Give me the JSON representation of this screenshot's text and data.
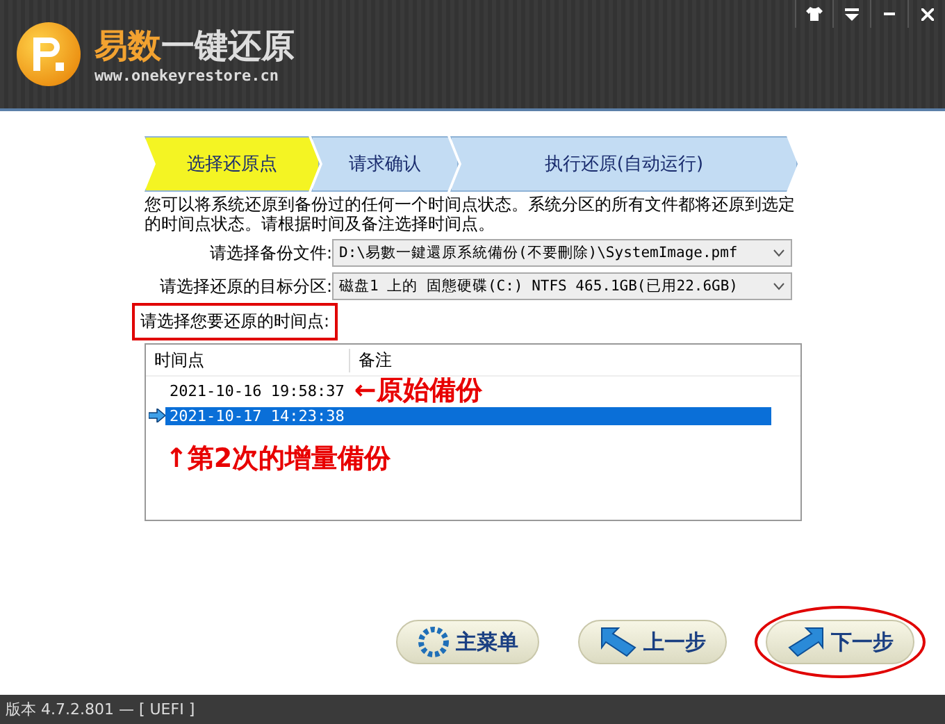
{
  "header": {
    "title_accent": "易数",
    "title_rest": "一键还原",
    "website": "www.onekeyrestore.cn"
  },
  "window_controls": [
    {
      "kind": "skin"
    },
    {
      "kind": "menu"
    },
    {
      "kind": "minimize"
    },
    {
      "kind": "close"
    }
  ],
  "steps": [
    {
      "label": "选择还原点",
      "selected": true
    },
    {
      "label": "请求确认",
      "selected": false
    },
    {
      "label": "执行还原(自动运行)",
      "selected": false
    }
  ],
  "description": "您可以将系统还原到备份过的任何一个时间点状态。系统分区的所有文件都将还原到选定的时间点状态。请根据时间及备注选择时间点。",
  "fields": [
    {
      "label": "请选择备份文件:",
      "value": "D:\\易數一鍵還原系統備份(不要刪除)\\SystemImage.pmf"
    },
    {
      "label": "请选择还原的目标分区:",
      "value": "磁盘1 上的 固態硬碟(C:) NTFS 465.1GB(已用22.6GB)"
    }
  ],
  "timepoint_label": {
    "text": "请选择您要还原的时间点:",
    "boxed": true
  },
  "table": {
    "columns": [
      "时间点",
      "备注"
    ],
    "rows": [
      {
        "time": "2021-10-16 19:58:37",
        "selected": false,
        "annotation": "←原始備份"
      },
      {
        "time": "2021-10-17 14:23:38",
        "selected": true,
        "annotation": ""
      }
    ]
  },
  "note": "↑第2次的增量備份",
  "buttons": [
    {
      "kind": "menu",
      "label": "主菜单",
      "circled": false
    },
    {
      "kind": "back",
      "label": "上一步",
      "circled": false
    },
    {
      "kind": "next",
      "label": "下一步",
      "circled": true
    }
  ],
  "footer": "版本 4.7.2.801 — [ UEFI ]"
}
